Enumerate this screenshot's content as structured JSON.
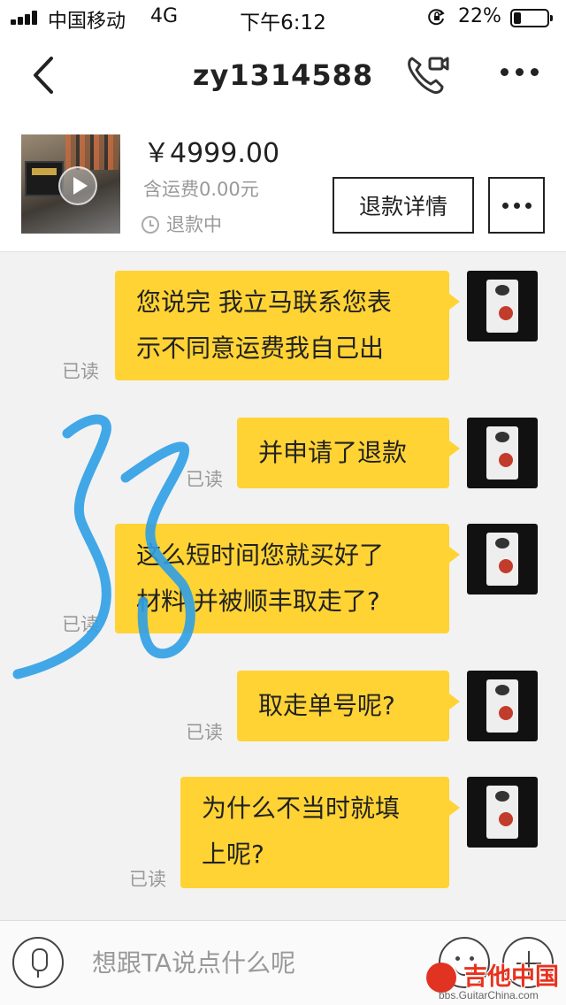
{
  "status_bar": {
    "carrier": "中国移动",
    "network": "4G",
    "time": "下午6:12",
    "battery": "22%"
  },
  "nav": {
    "title": "zy1314588",
    "icons": [
      "back-arrow-icon",
      "phone-video-icon",
      "more-icon"
    ]
  },
  "product": {
    "price": "￥4999.00",
    "shipping": "含运费0.00元",
    "status": "退款中",
    "refund_button": "退款详情"
  },
  "messages": [
    {
      "lines": [
        "您说完 我立马联系您表",
        "示不同意运费我自己出"
      ],
      "read": "已读"
    },
    {
      "lines": [
        "并申请了退款"
      ],
      "read": "已读"
    },
    {
      "lines": [
        "这么短时间您就买好了",
        "材料 并被顺丰取走了?"
      ],
      "read": "已读"
    },
    {
      "lines": [
        "取走单号呢?"
      ],
      "read": "已读"
    },
    {
      "lines": [
        "为什么不当时就填",
        "上呢?"
      ],
      "read": "已读"
    }
  ],
  "input": {
    "placeholder": "想跟TA说点什么呢"
  },
  "watermark": {
    "text": "吉他中国",
    "url": "bbs.GuitarChina.com"
  },
  "annotation": {
    "color": "#2f9ee6"
  }
}
